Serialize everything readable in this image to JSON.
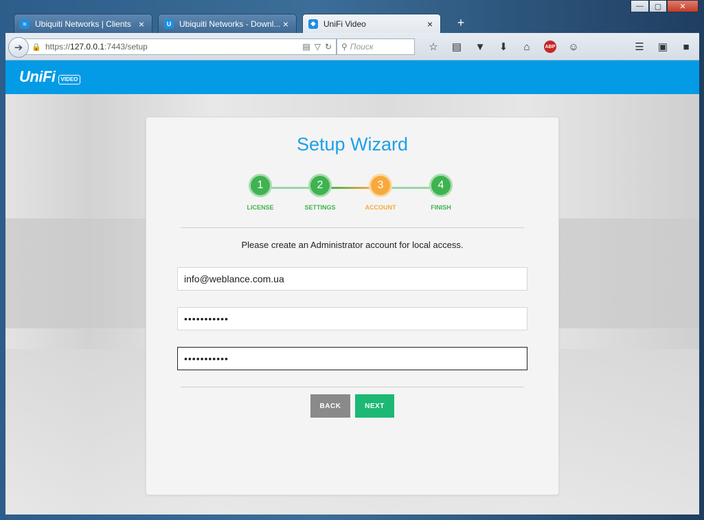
{
  "browser": {
    "tabs": [
      {
        "title": "Ubiquiti Networks | Clients",
        "close": "×",
        "active": false
      },
      {
        "title": "Ubiquiti Networks - Downl...",
        "close": "×",
        "active": false
      },
      {
        "title": "UniFi Video",
        "close": "×",
        "active": true
      }
    ],
    "new_tab": "+",
    "url_scheme": "https://",
    "url_host": "127.0.0.1",
    "url_path": ":7443/setup",
    "search_placeholder": "Поиск"
  },
  "app": {
    "logo": "UniFi",
    "logo_badge": "VIDEO"
  },
  "wizard": {
    "title": "Setup Wizard",
    "steps": [
      {
        "number": "1",
        "label": "LICENSE",
        "state": "done"
      },
      {
        "number": "2",
        "label": "SETTINGS",
        "state": "done"
      },
      {
        "number": "3",
        "label": "ACCOUNT",
        "state": "current"
      },
      {
        "number": "4",
        "label": "FINISH",
        "state": "done"
      }
    ],
    "instruction": "Please create an Administrator account for local access.",
    "email_value": "info@weblance.com.ua",
    "password_value": "•••••••••••",
    "confirm_value": "•••••••••••",
    "back_label": "BACK",
    "next_label": "NEXT"
  },
  "colors": {
    "header_blue": "#039be5",
    "step_done": "#3fb34f",
    "step_current": "#f9a93c",
    "next_button": "#1cb874",
    "back_button": "#8a8a8a"
  }
}
